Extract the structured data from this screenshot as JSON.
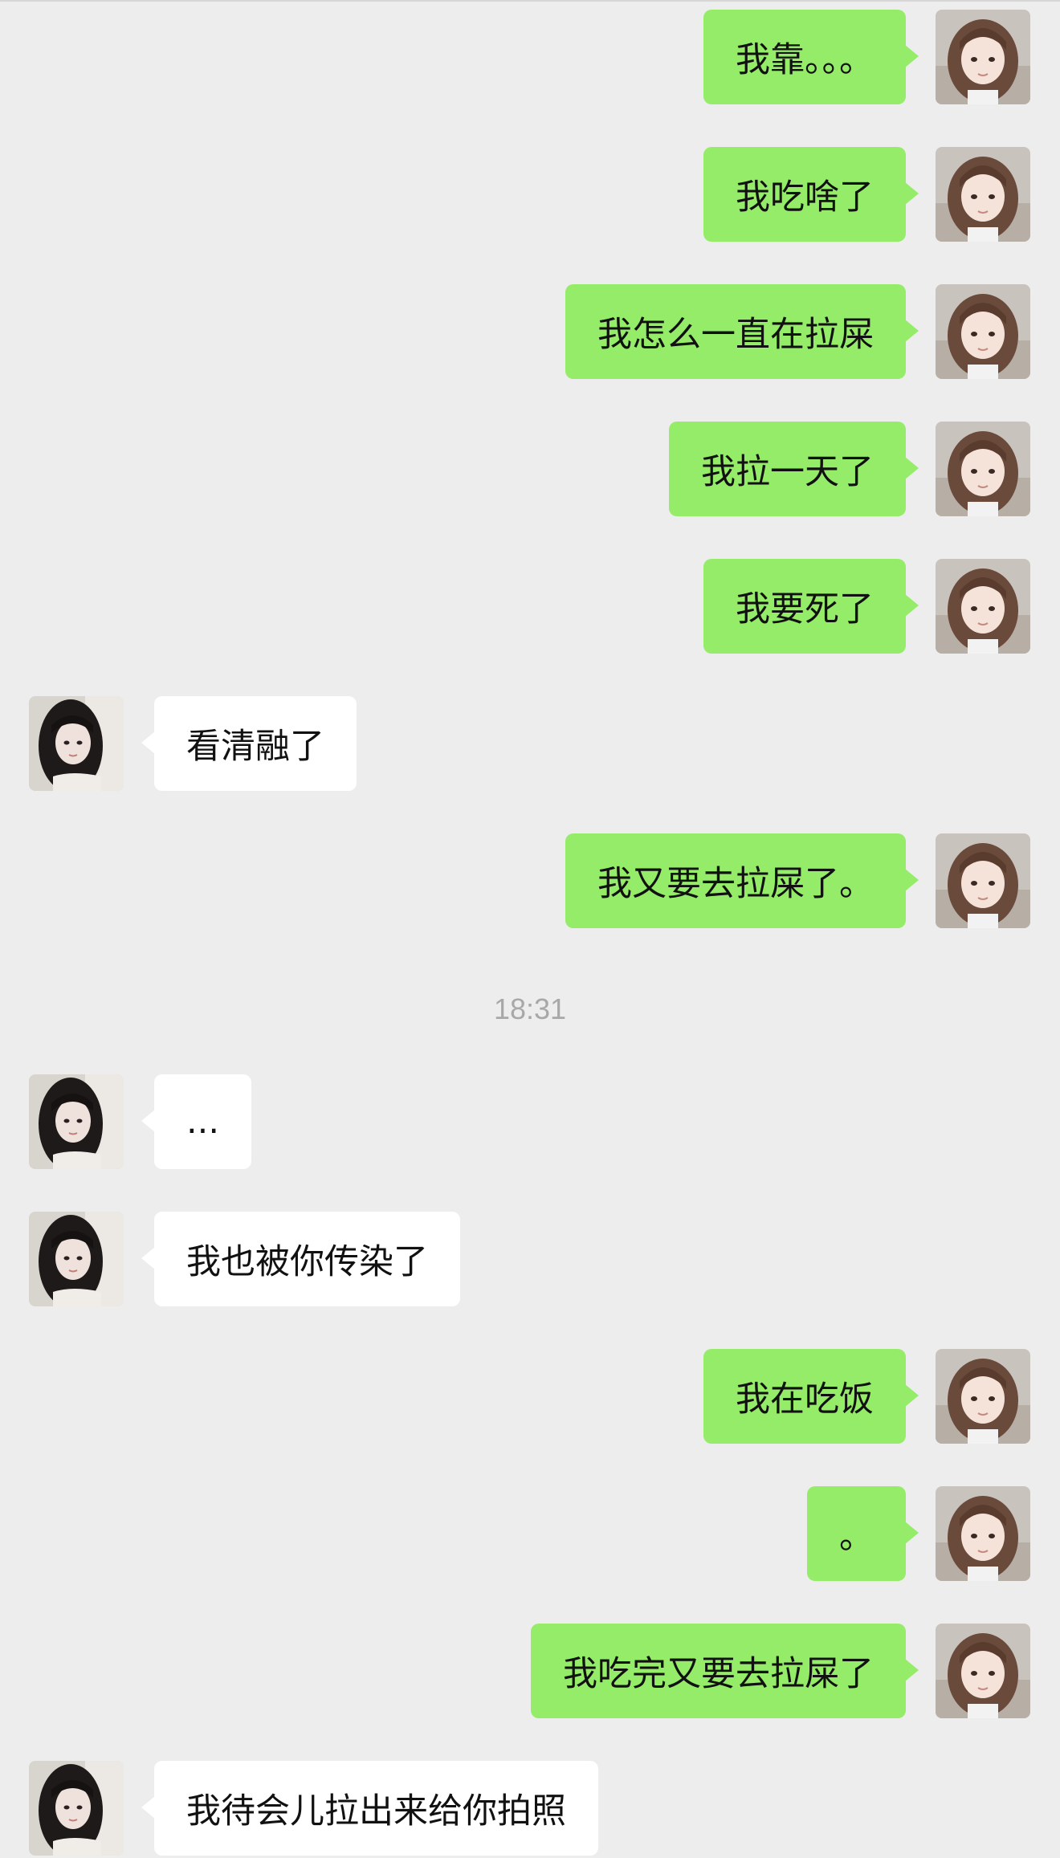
{
  "timestamp": "18:31",
  "messages": [
    {
      "side": "out",
      "text": "我靠。。。"
    },
    {
      "side": "out",
      "text": "我吃啥了"
    },
    {
      "side": "out",
      "text": "我怎么一直在拉屎"
    },
    {
      "side": "out",
      "text": "我拉一天了"
    },
    {
      "side": "out",
      "text": "我要死了"
    },
    {
      "side": "in",
      "text": "看清融了"
    },
    {
      "side": "out",
      "text": "我又要去拉屎了。"
    },
    {
      "side": "in",
      "text": "..."
    },
    {
      "side": "in",
      "text": "我也被你传染了"
    },
    {
      "side": "out",
      "text": "我在吃饭"
    },
    {
      "side": "out",
      "text": "。"
    },
    {
      "side": "out",
      "text": "我吃完又要去拉屎了"
    },
    {
      "side": "in",
      "text": "我待会儿拉出来给你拍照"
    }
  ]
}
